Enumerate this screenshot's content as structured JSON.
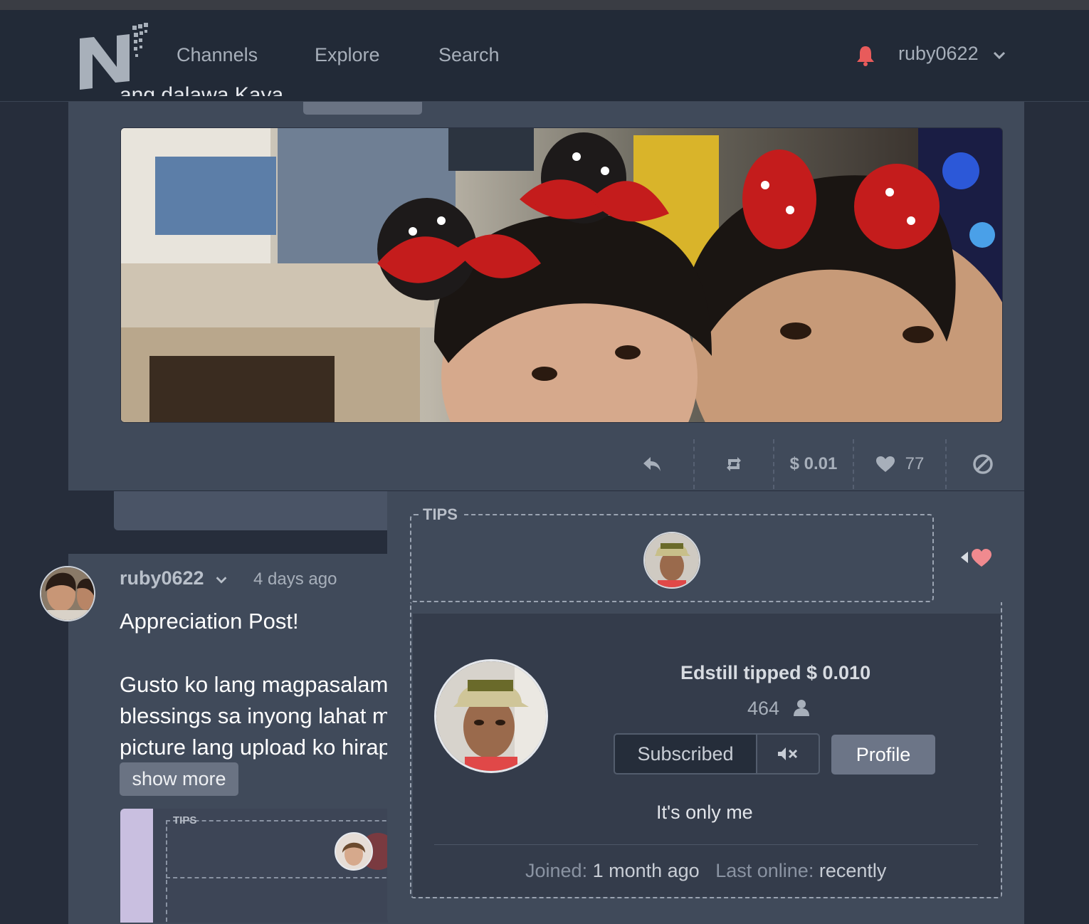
{
  "nav": {
    "items": [
      "Channels",
      "Explore",
      "Search"
    ],
    "username": "ruby0622"
  },
  "post1": {
    "truncated_text": "ang dalawa Kaya...",
    "actions": {
      "tips_amount": "$ 0.01",
      "likes": "77"
    }
  },
  "post2": {
    "username": "ruby0622",
    "time": "4 days ago",
    "title": "Appreciation Post!",
    "body_lines": [
      "Gusto ko lang magpasalama",
      "blessings sa inyong lahat ma",
      "picture lang upload ko hirap"
    ],
    "show_more": "show more",
    "thumb_tips_label": "TIPS"
  },
  "tips_popover": {
    "label": "TIPS",
    "tipper": {
      "tipped_text": "Edstill tipped $ 0.010",
      "subscribers": "464",
      "subscribed_label": "Subscribed",
      "profile_label": "Profile",
      "bio": "It's only me",
      "joined_label": "Joined:",
      "joined_value": "1 month ago",
      "last_online_label": "Last online:",
      "last_online_value": "recently"
    }
  },
  "colors": {
    "navbar": "#222a37",
    "card": "#404a5a",
    "bell": "#e85b5b",
    "heart": "#f08a8f"
  }
}
